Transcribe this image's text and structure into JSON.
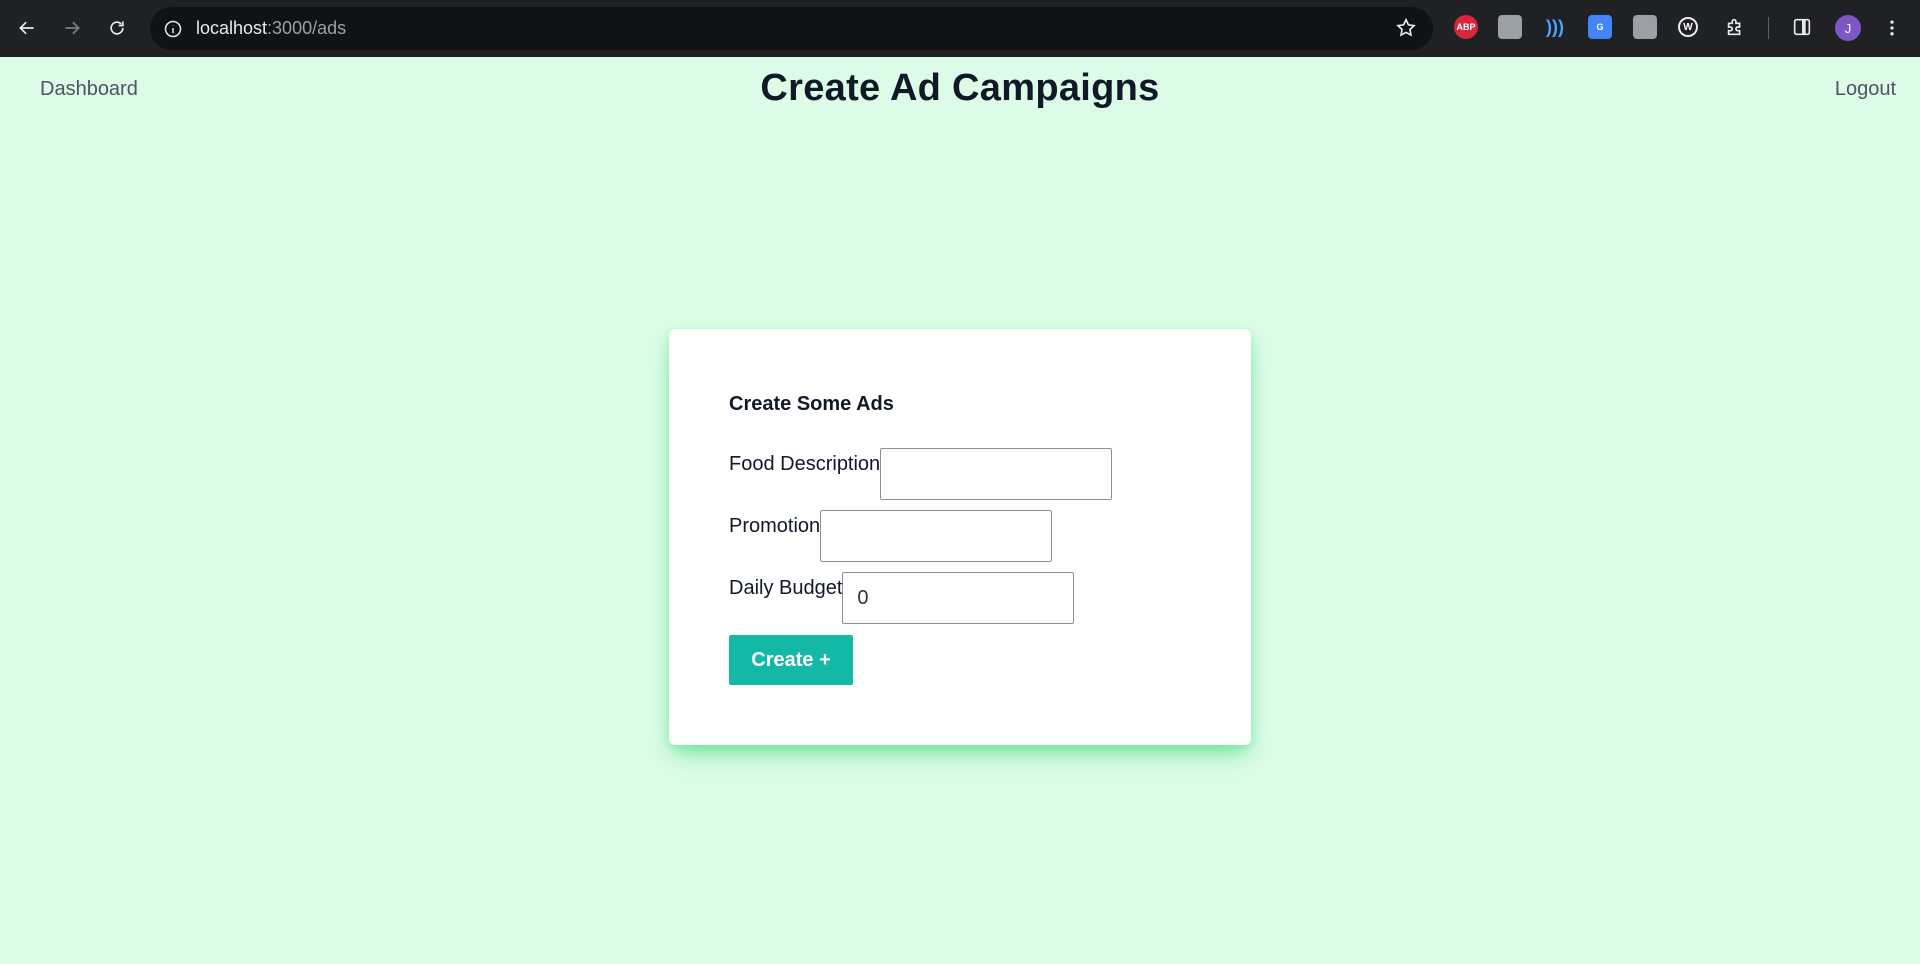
{
  "browser": {
    "url_host": "localhost",
    "url_path": ":3000/ads",
    "extensions": [
      {
        "name": "adblock-plus-icon",
        "label": "ABP"
      },
      {
        "name": "extension-2-icon",
        "label": ""
      },
      {
        "name": "extension-3-icon",
        "label": ")))"
      },
      {
        "name": "google-translate-icon",
        "label": "G"
      },
      {
        "name": "extension-5-icon",
        "label": ""
      },
      {
        "name": "extension-6-icon",
        "label": "W"
      }
    ],
    "avatar_initial": "J"
  },
  "nav": {
    "dashboard": "Dashboard",
    "title": "Create Ad Campaigns",
    "logout": "Logout"
  },
  "form": {
    "heading": "Create Some Ads",
    "fields": [
      {
        "label": "Food Description",
        "value": ""
      },
      {
        "label": "Promotion",
        "value": ""
      },
      {
        "label": "Daily Budget",
        "value": "0"
      }
    ],
    "submit_label": "Create +"
  },
  "colors": {
    "page_background": "#dcfce7",
    "accent": "#14b8a6",
    "card_shadow": "#4ade80"
  }
}
